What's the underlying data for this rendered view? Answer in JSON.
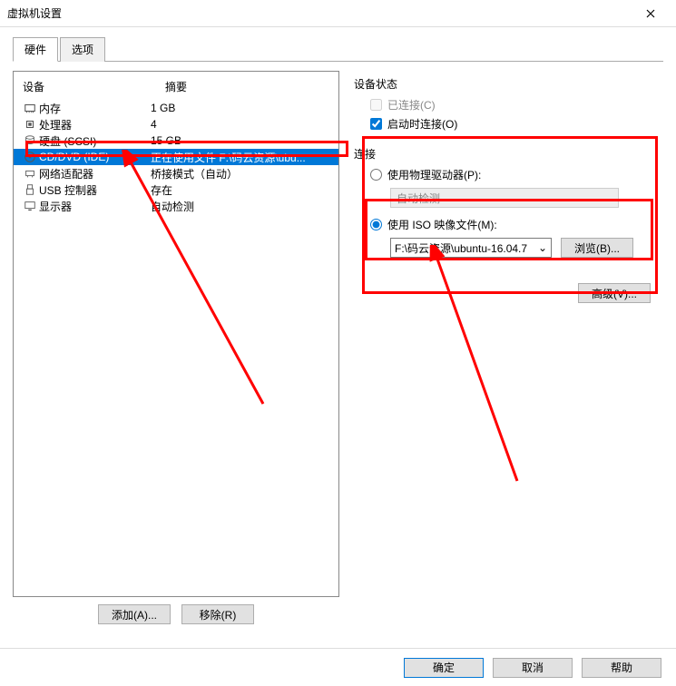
{
  "title": "虚拟机设置",
  "tabs": {
    "hardware": "硬件",
    "options": "选项"
  },
  "headers": {
    "device": "设备",
    "summary": "摘要"
  },
  "devices": [
    {
      "icon": "memory",
      "name": "内存",
      "value": "1 GB"
    },
    {
      "icon": "cpu",
      "name": "处理器",
      "value": "4"
    },
    {
      "icon": "disk",
      "name": "硬盘 (SCSI)",
      "value": "15 GB"
    },
    {
      "icon": "cd",
      "name": "CD/DVD (IDE)",
      "value": "正在使用文件 F:\\码云资源\\ubu..."
    },
    {
      "icon": "net",
      "name": "网络适配器",
      "value": "桥接模式（自动）"
    },
    {
      "icon": "usb",
      "name": "USB 控制器",
      "value": "存在"
    },
    {
      "icon": "display",
      "name": "显示器",
      "value": "自动检测"
    }
  ],
  "selected_index": 3,
  "buttons": {
    "add": "添加(A)...",
    "remove": "移除(R)",
    "browse": "浏览(B)...",
    "advanced": "高级(V)...",
    "ok": "确定",
    "cancel": "取消",
    "help": "帮助"
  },
  "status": {
    "group": "设备状态",
    "connected": "已连接(C)",
    "connect_at_power_on": "启动时连接(O)"
  },
  "connection": {
    "group": "连接",
    "use_physical": "使用物理驱动器(P):",
    "auto_detect": "自动检测",
    "use_iso": "使用 ISO 映像文件(M):",
    "iso_path": "F:\\码云资源\\ubuntu-16.04.7"
  }
}
